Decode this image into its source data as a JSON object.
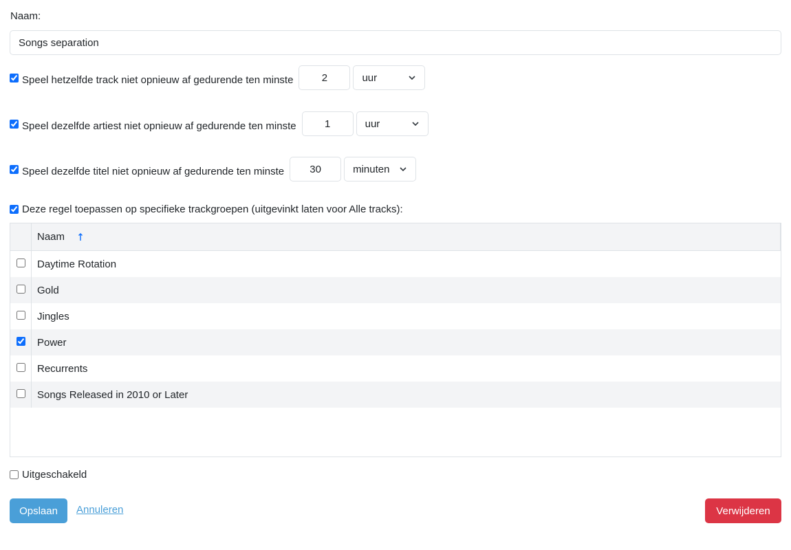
{
  "form": {
    "name_label": "Naam:",
    "name_value": "Songs separation"
  },
  "rules": [
    {
      "label": "Speel hetzelfde track niet opnieuw af gedurende ten minste",
      "checked": true,
      "value": "2",
      "unit": "uur"
    },
    {
      "label": "Speel dezelfde artiest niet opnieuw af gedurende ten minste",
      "checked": true,
      "value": "1",
      "unit": "uur"
    },
    {
      "label": "Speel dezelfde titel niet opnieuw af gedurende ten minste",
      "checked": true,
      "value": "30",
      "unit": "minuten"
    }
  ],
  "groups": {
    "label": "Deze regel toepassen op specifieke trackgroepen (uitgevinkt laten voor Alle tracks):",
    "checked": true,
    "column_header": "Naam",
    "sort_icon": "arrow-up-icon",
    "rows": [
      {
        "name": "Daytime Rotation",
        "checked": false
      },
      {
        "name": "Gold",
        "checked": false
      },
      {
        "name": "Jingles",
        "checked": false
      },
      {
        "name": "Power",
        "checked": true
      },
      {
        "name": "Recurrents",
        "checked": false
      },
      {
        "name": "Songs Released in 2010 or Later",
        "checked": false
      }
    ]
  },
  "disabled": {
    "label": "Uitgeschakeld",
    "checked": false
  },
  "actions": {
    "save_label": "Opslaan",
    "cancel_label": "Annuleren",
    "delete_label": "Verwijderen"
  },
  "colors": {
    "primary": "#4a9fd8",
    "danger": "#dc3545",
    "checkbox": "#0d6efd"
  }
}
